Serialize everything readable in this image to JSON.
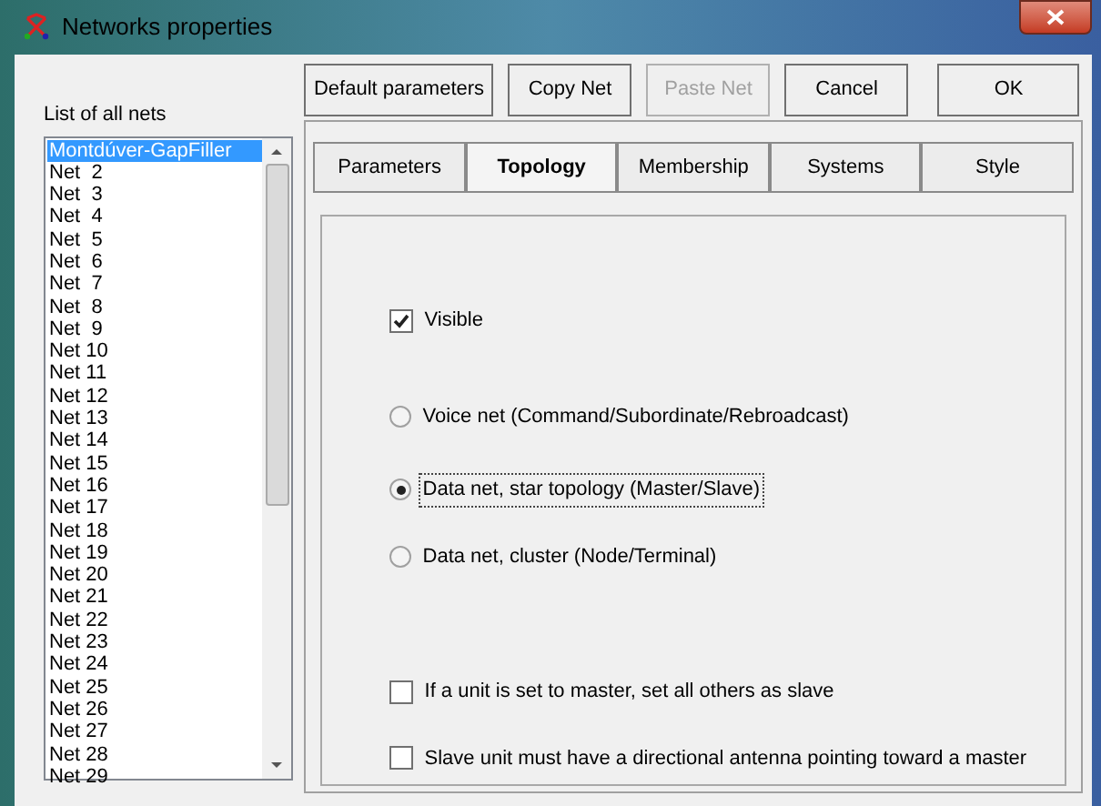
{
  "window": {
    "title": "Networks properties"
  },
  "list": {
    "label": "List of all nets",
    "items": [
      {
        "label": "Montdúver-GapFiller",
        "selected": true
      },
      {
        "label": "Net  2",
        "selected": false
      },
      {
        "label": "Net  3",
        "selected": false
      },
      {
        "label": "Net  4",
        "selected": false
      },
      {
        "label": "Net  5",
        "selected": false
      },
      {
        "label": "Net  6",
        "selected": false
      },
      {
        "label": "Net  7",
        "selected": false
      },
      {
        "label": "Net  8",
        "selected": false
      },
      {
        "label": "Net  9",
        "selected": false
      },
      {
        "label": "Net 10",
        "selected": false
      },
      {
        "label": "Net 11",
        "selected": false
      },
      {
        "label": "Net 12",
        "selected": false
      },
      {
        "label": "Net 13",
        "selected": false
      },
      {
        "label": "Net 14",
        "selected": false
      },
      {
        "label": "Net 15",
        "selected": false
      },
      {
        "label": "Net 16",
        "selected": false
      },
      {
        "label": "Net 17",
        "selected": false
      },
      {
        "label": "Net 18",
        "selected": false
      },
      {
        "label": "Net 19",
        "selected": false
      },
      {
        "label": "Net 20",
        "selected": false
      },
      {
        "label": "Net 21",
        "selected": false
      },
      {
        "label": "Net 22",
        "selected": false
      },
      {
        "label": "Net 23",
        "selected": false
      },
      {
        "label": "Net 24",
        "selected": false
      },
      {
        "label": "Net 25",
        "selected": false
      },
      {
        "label": "Net 26",
        "selected": false
      },
      {
        "label": "Net 27",
        "selected": false
      },
      {
        "label": "Net 28",
        "selected": false
      },
      {
        "label": "Net 29",
        "selected": false
      }
    ]
  },
  "buttons": [
    {
      "label": "Default parameters",
      "disabled": false
    },
    {
      "label": "Copy Net",
      "disabled": false
    },
    {
      "label": "Paste Net",
      "disabled": true
    },
    {
      "label": "Cancel",
      "disabled": false
    },
    {
      "label": "OK",
      "disabled": false
    }
  ],
  "tabs": [
    {
      "label": "Parameters",
      "selected": false
    },
    {
      "label": "Topology",
      "selected": true
    },
    {
      "label": "Membership",
      "selected": false
    },
    {
      "label": "Systems",
      "selected": false
    },
    {
      "label": "Style",
      "selected": false
    }
  ],
  "options": [
    {
      "kind": "checkbox",
      "label": "Visible",
      "checked": true,
      "focused": false
    },
    {
      "kind": "radio",
      "label": "Voice net (Command/Subordinate/Rebroadcast)",
      "selected": false,
      "focused": false
    },
    {
      "kind": "radio",
      "label": "Data net, star topology (Master/Slave)",
      "selected": true,
      "focused": true
    },
    {
      "kind": "radio",
      "label": "Data net, cluster (Node/Terminal)",
      "selected": false,
      "focused": false
    },
    {
      "kind": "checkbox",
      "label": "If a unit is set to master, set all others as slave",
      "checked": false,
      "focused": false
    },
    {
      "kind": "checkbox",
      "label": "Slave unit must have a directional antenna pointing toward a master",
      "checked": false,
      "focused": false
    }
  ]
}
